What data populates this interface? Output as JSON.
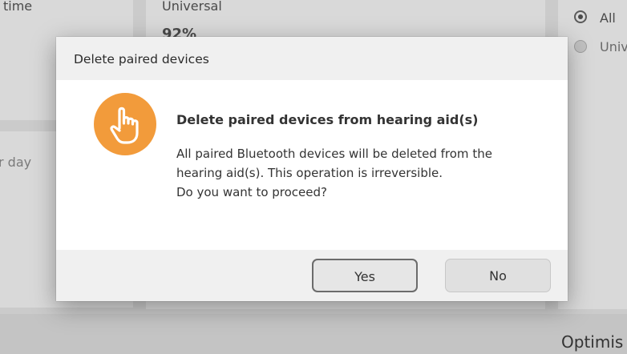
{
  "background": {
    "left_label": "time",
    "middle_label": "Universal",
    "middle_value": "92%",
    "lower_left_label": "r day",
    "radio_all_label": "All",
    "radio_universal_label": "Univ",
    "bottom_right_label": "Optimis"
  },
  "dialog": {
    "header_title": "Delete paired devices",
    "icon": "pointing-hand-icon",
    "title": "Delete paired devices from hearing aid(s)",
    "message_lines": [
      "All paired Bluetooth devices will be deleted from the",
      "hearing aid(s). This operation is irreversible.",
      "Do you want to proceed?"
    ],
    "yes_label": "Yes",
    "no_label": "No",
    "accent_color": "#f29b3b"
  }
}
